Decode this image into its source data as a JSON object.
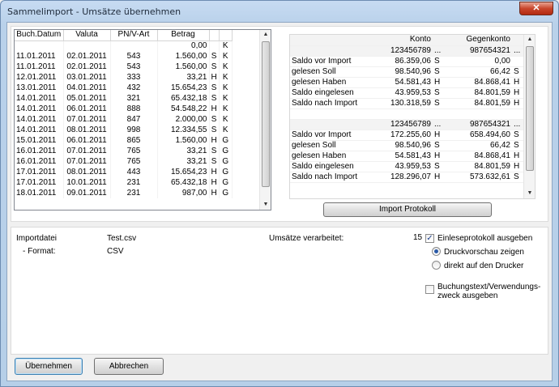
{
  "window": {
    "title": "Sammelimport - Umsätze übernehmen",
    "close_label": "✕"
  },
  "left_table": {
    "headers": [
      "Buch.Datum",
      "Valuta",
      "PN/V-Art",
      "Betrag",
      "",
      ""
    ],
    "rows": [
      [
        "",
        "",
        "",
        "0,00",
        "",
        "K"
      ],
      [
        "11.01.2011",
        "02.01.2011",
        "543",
        "1.560,00",
        "S",
        "K"
      ],
      [
        "11.01.2011",
        "02.01.2011",
        "543",
        "1.560,00",
        "S",
        "K"
      ],
      [
        "12.01.2011",
        "03.01.2011",
        "333",
        "33,21",
        "H",
        "K"
      ],
      [
        "13.01.2011",
        "04.01.2011",
        "432",
        "15.654,23",
        "S",
        "K"
      ],
      [
        "14.01.2011",
        "05.01.2011",
        "321",
        "65.432,18",
        "S",
        "K"
      ],
      [
        "14.01.2011",
        "06.01.2011",
        "888",
        "54.548,22",
        "H",
        "K"
      ],
      [
        "14.01.2011",
        "07.01.2011",
        "847",
        "2.000,00",
        "S",
        "K"
      ],
      [
        "14.01.2011",
        "08.01.2011",
        "998",
        "12.334,55",
        "S",
        "K"
      ],
      [
        "15.01.2011",
        "06.01.2011",
        "865",
        "1.560,00",
        "H",
        "G"
      ],
      [
        "16.01.2011",
        "07.01.2011",
        "765",
        "33,21",
        "S",
        "G"
      ],
      [
        "16.01.2011",
        "07.01.2011",
        "765",
        "33,21",
        "S",
        "G"
      ],
      [
        "17.01.2011",
        "08.01.2011",
        "443",
        "15.654,23",
        "H",
        "G"
      ],
      [
        "17.01.2011",
        "10.01.2011",
        "231",
        "65.432,18",
        "H",
        "G"
      ],
      [
        "18.01.2011",
        "09.01.2011",
        "231",
        "987,00",
        "H",
        "G"
      ]
    ]
  },
  "right_table": {
    "headers": [
      "",
      "Konto",
      "",
      "Gegenkonto",
      ""
    ],
    "rows": [
      [
        "",
        "123456789",
        "...",
        "987654321",
        "..."
      ],
      [
        "Saldo vor Import",
        "86.359,06",
        "S",
        "0,00",
        ""
      ],
      [
        "gelesen Soll",
        "98.540,96",
        "S",
        "66,42",
        "S"
      ],
      [
        "gelesen Haben",
        "54.581,43",
        "H",
        "84.868,41",
        "H"
      ],
      [
        "Saldo eingelesen",
        "43.959,53",
        "S",
        "84.801,59",
        "H"
      ],
      [
        "Saldo nach Import",
        "130.318,59",
        "S",
        "84.801,59",
        "H"
      ],
      [
        "",
        "",
        "",
        "",
        ""
      ],
      [
        "",
        "123456789",
        "...",
        "987654321",
        "..."
      ],
      [
        "Saldo vor Import",
        "172.255,60",
        "H",
        "658.494,60",
        "S"
      ],
      [
        "gelesen Soll",
        "98.540,96",
        "S",
        "66,42",
        "S"
      ],
      [
        "gelesen Haben",
        "54.581,43",
        "H",
        "84.868,41",
        "H"
      ],
      [
        "Saldo eingelesen",
        "43.959,53",
        "S",
        "84.801,59",
        "H"
      ],
      [
        "Saldo nach Import",
        "128.296,07",
        "H",
        "573.632,61",
        "S"
      ]
    ]
  },
  "protokoll_button": "Import Protokoll",
  "info": {
    "importdatei_label": "Importdatei",
    "importdatei_value": "Test.csv",
    "format_label": "- Format:",
    "format_value": "CSV",
    "umsaetze_label": "Umsätze verarbeitet:",
    "umsaetze_value": "15"
  },
  "options": {
    "einleseprotokoll_label": "Einleseprotokoll ausgeben",
    "einleseprotokoll_checked": true,
    "druckvorschau_label": "Druckvorschau zeigen",
    "drucker_label": "direkt auf den Drucker",
    "buchungstext_label_1": "Buchungstext/Verwendungs-",
    "buchungstext_label_2": "zweck ausgeben",
    "buchungstext_checked": false
  },
  "buttons": {
    "ok": "Übernehmen",
    "cancel": "Abbrechen"
  },
  "icons": [
    "close-icon",
    "scroll-up-icon",
    "scroll-down-icon",
    "checkmark-icon",
    "radio-selected-icon"
  ]
}
